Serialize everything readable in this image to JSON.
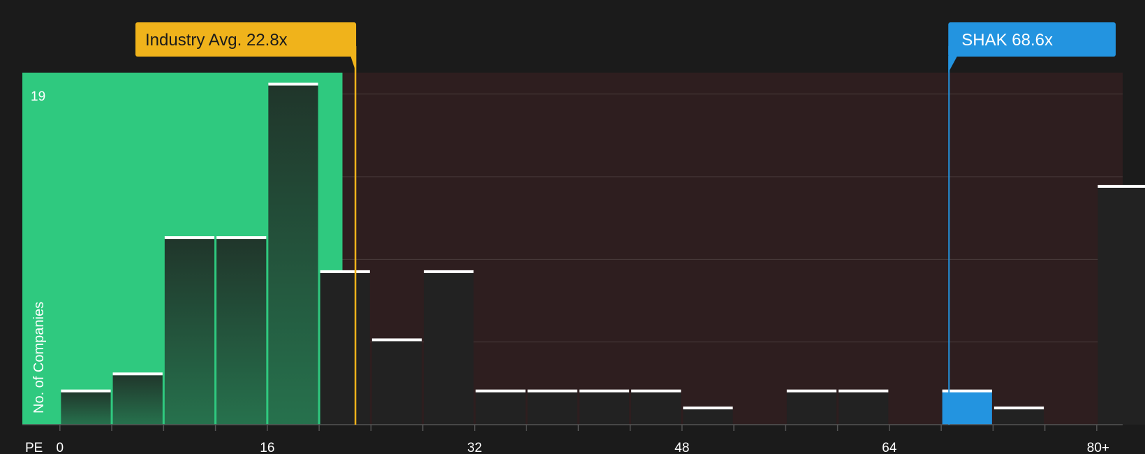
{
  "chart_data": {
    "type": "bar",
    "title": "",
    "xlabel": "PE",
    "ylabel": "No. of Companies",
    "x_ticks": [
      "0",
      "16",
      "32",
      "48",
      "64",
      "80+"
    ],
    "y_ticks": [
      "19"
    ],
    "ylim": [
      0,
      20
    ],
    "xlim": [
      -2.9,
      82
    ],
    "bin_width": 4,
    "bins": [
      {
        "start": 0,
        "count": 2
      },
      {
        "start": 4,
        "count": 3
      },
      {
        "start": 8,
        "count": 11
      },
      {
        "start": 12,
        "count": 11
      },
      {
        "start": 16,
        "count": 20
      },
      {
        "start": 20,
        "count": 9
      },
      {
        "start": 24,
        "count": 5
      },
      {
        "start": 28,
        "count": 9
      },
      {
        "start": 32,
        "count": 2
      },
      {
        "start": 36,
        "count": 2
      },
      {
        "start": 40,
        "count": 2
      },
      {
        "start": 44,
        "count": 2
      },
      {
        "start": 48,
        "count": 1
      },
      {
        "start": 52,
        "count": 0
      },
      {
        "start": 56,
        "count": 2
      },
      {
        "start": 60,
        "count": 2
      },
      {
        "start": 64,
        "count": 0
      },
      {
        "start": 68,
        "count": 2,
        "highlight": true
      },
      {
        "start": 72,
        "count": 1
      },
      {
        "start": 76,
        "count": 0
      },
      {
        "start": 80,
        "count": 14
      }
    ],
    "fair_zone_end": 21.8,
    "industry_avg": {
      "label": "Industry Avg. 22.8x",
      "value": 22.8
    },
    "company": {
      "label": "SHAK 68.6x",
      "value": 68.6
    },
    "colors": {
      "background": "#1b1b1b",
      "fair_zone": "#2fc97f",
      "expensive_zone": "#2e1e1f",
      "bar_dark": "#222222",
      "industry": "#f0b31b",
      "company": "#2394e0",
      "bar_cap": "#ffffff"
    }
  }
}
